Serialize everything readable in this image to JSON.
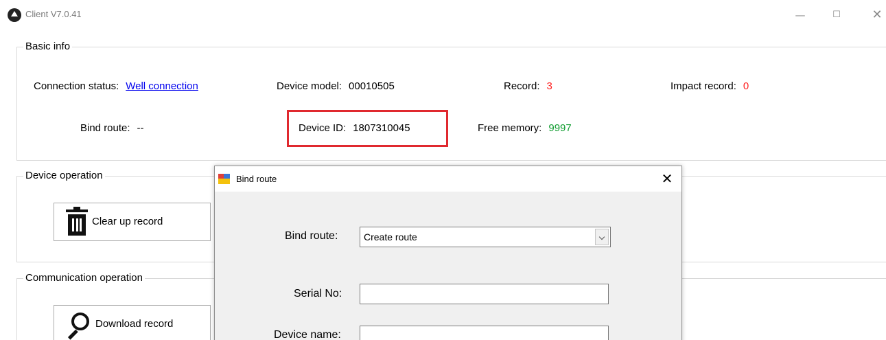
{
  "window": {
    "title": "Client V7.0.41",
    "minimize_glyph": "—",
    "maximize_glyph": "☐",
    "close_glyph": "✕"
  },
  "basic_info": {
    "title": "Basic info",
    "connection_status_label": "Connection status:",
    "connection_status_value": "Well connection",
    "device_model_label": "Device model:",
    "device_model_value": "00010505",
    "record_label": "Record:",
    "record_value": "3",
    "impact_record_label": "Impact record:",
    "impact_record_value": "0",
    "bind_route_label": "Bind route:",
    "bind_route_value": "--",
    "device_id_label": "Device ID:",
    "device_id_value": "1807310045",
    "free_memory_label": "Free memory:",
    "free_memory_value": "9997"
  },
  "device_operation": {
    "title": "Device operation",
    "clear_button_label": "Clear up record"
  },
  "communication_operation": {
    "title": "Communication operation",
    "download_button_label": "Download record"
  },
  "dialog": {
    "title": "Bind route",
    "close_glyph": "✕",
    "bind_route_label": "Bind route:",
    "bind_route_selected": "Create route",
    "serial_no_label": "Serial No:",
    "serial_no_value": "",
    "device_name_label": "Device name:",
    "device_name_value": ""
  },
  "colors": {
    "link": "#0000ee",
    "alert_red": "#ff2020",
    "ok_green": "#0f9c2f",
    "highlight_box": "#e0292f"
  }
}
